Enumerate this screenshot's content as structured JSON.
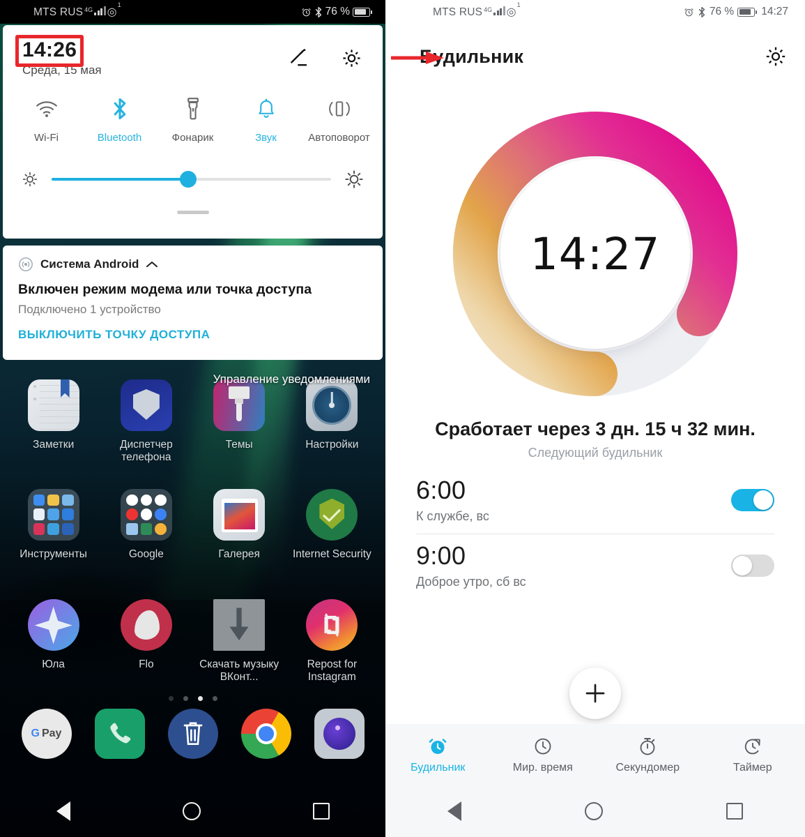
{
  "left_phone": {
    "statusbar": {
      "carrier": "MTS RUS",
      "network": "4G",
      "hotspot_badge": "1",
      "battery_percent": "76 %",
      "alarm_icon": "alarm-clock-icon",
      "bluetooth_icon": "bluetooth-icon"
    },
    "quick_settings": {
      "time": "14:26",
      "date": "Среда, 15 мая",
      "edit_icon": "edit-pencil-icon",
      "settings_icon": "gear-icon",
      "toggles": [
        {
          "label": "Wi-Fi",
          "icon": "wifi-icon",
          "active": false
        },
        {
          "label": "Bluetooth",
          "icon": "bluetooth-icon",
          "active": true
        },
        {
          "label": "Фонарик",
          "icon": "flashlight-icon",
          "active": false
        },
        {
          "label": "Звук",
          "icon": "bell-icon",
          "active": true
        },
        {
          "label": "Автоповорот",
          "icon": "auto-rotate-icon",
          "active": false
        }
      ],
      "brightness": {
        "low_icon": "brightness-low-icon",
        "high_icon": "brightness-high-icon",
        "value_percent": 49
      }
    },
    "notification": {
      "app_icon": "hotspot-icon",
      "app_name": "Система Android",
      "collapse_icon": "chevron-up-icon",
      "title": "Включен режим модема или точка доступа",
      "subtitle": "Подключено 1 устройство",
      "action": "ВЫКЛЮЧИТЬ ТОЧКУ ДОСТУПА"
    },
    "notification_manage_label": "Управление уведомлениями",
    "home_rows": [
      [
        {
          "label": "Заметки",
          "icon": "notes-icon"
        },
        {
          "label": "Диспетчер телефона",
          "icon": "phone-manager-icon"
        },
        {
          "label": "Темы",
          "icon": "themes-icon"
        },
        {
          "label": "Настройки",
          "icon": "settings-icon"
        }
      ],
      [
        {
          "label": "Инструменты",
          "icon": "tools-folder-icon"
        },
        {
          "label": "Google",
          "icon": "google-folder-icon"
        },
        {
          "label": "Галерея",
          "icon": "gallery-icon"
        },
        {
          "label": "Internet Security",
          "icon": "internet-security-icon"
        }
      ],
      [
        {
          "label": "Юла",
          "icon": "yula-icon"
        },
        {
          "label": "Flo",
          "icon": "flo-icon"
        },
        {
          "label": "Скачать музыку ВКонт...",
          "icon": "download-music-icon"
        },
        {
          "label": "Repost for Instagram",
          "icon": "repost-instagram-icon"
        }
      ]
    ],
    "page_dots": {
      "count": 4,
      "active_index": 2
    },
    "dock": [
      {
        "label": "G Pay",
        "icon": "google-pay-icon"
      },
      {
        "label": "Телефон",
        "icon": "phone-icon"
      },
      {
        "label": "Корзина",
        "icon": "trash-icon"
      },
      {
        "label": "Chrome",
        "icon": "chrome-icon"
      },
      {
        "label": "Камера",
        "icon": "camera-icon"
      }
    ],
    "navbar": {
      "back": "back-icon",
      "home": "home-icon",
      "recents": "recents-icon"
    }
  },
  "right_phone": {
    "statusbar": {
      "carrier": "MTS RUS",
      "network": "4G",
      "hotspot_badge": "1",
      "battery_percent": "76 %",
      "clock": "14:27"
    },
    "appbar": {
      "title": "Будильник",
      "settings_icon": "gear-icon",
      "annotation_arrow": "red-arrow-annotation"
    },
    "clock_widget": {
      "time": "14:27",
      "ring_start_color": "#f0d9a8",
      "ring_mid_color": "#e09a42",
      "ring_end_color": "#e2188f",
      "ring_track_color": "#eceef2"
    },
    "next_alarm": {
      "title": "Сработает через 3 дн. 15 ч 32 мин.",
      "subtitle": "Следующий будильник"
    },
    "alarms": [
      {
        "time": "6:00",
        "label": "К службе, вс",
        "enabled": true
      },
      {
        "time": "9:00",
        "label": "Доброе утро, сб вс",
        "enabled": false
      }
    ],
    "fab": {
      "icon": "plus-icon"
    },
    "tabs": [
      {
        "label": "Будильник",
        "icon": "alarm-icon",
        "active": true
      },
      {
        "label": "Мир. время",
        "icon": "world-clock-icon",
        "active": false
      },
      {
        "label": "Секундомер",
        "icon": "stopwatch-icon",
        "active": false
      },
      {
        "label": "Таймер",
        "icon": "timer-icon",
        "active": false
      }
    ],
    "navbar": {
      "back": "back-icon",
      "home": "home-icon",
      "recents": "recents-icon"
    },
    "accent_color": "#19b4e5"
  }
}
